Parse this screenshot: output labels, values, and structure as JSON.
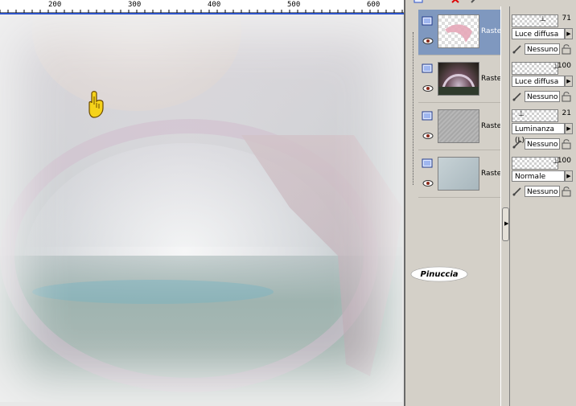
{
  "ruler": {
    "ticks": [
      "200",
      "300",
      "400",
      "500",
      "600"
    ]
  },
  "layers": [
    {
      "name": "Raste",
      "selected": true,
      "thumbnail": "transparent-pink-drape"
    },
    {
      "name": "Raste",
      "selected": false,
      "thumbnail": "landscape-arch"
    },
    {
      "name": "Raste",
      "selected": false,
      "thumbnail": "grey-texture"
    },
    {
      "name": "Raste",
      "selected": false,
      "thumbnail": "blue-grey-gradient"
    }
  ],
  "properties": [
    {
      "opacity": "71",
      "opacity_fraction": 0.71,
      "blend_mode": "Luce diffusa",
      "mask": "Nessuno"
    },
    {
      "opacity": "100",
      "opacity_fraction": 1.0,
      "blend_mode": "Luce diffusa",
      "mask": "Nessuno"
    },
    {
      "opacity": "21",
      "opacity_fraction": 0.21,
      "blend_mode": "Luminanza (L)",
      "mask": "Nessuno"
    },
    {
      "opacity": "100",
      "opacity_fraction": 1.0,
      "blend_mode": "Normale",
      "mask": "Nessuno"
    }
  ],
  "signature": "Pinuccia",
  "colors": {
    "selected_layer": "#7f98bf",
    "panel_bg": "#d4d0c8",
    "ruler_border": "#2b52c8"
  },
  "icons": [
    "new-layer-icon",
    "delete-layer-icon",
    "brush-icon",
    "eye-icon",
    "raster-layer-icon",
    "lock-icon",
    "pointing-hand-icon",
    "chevron-right-icon"
  ]
}
